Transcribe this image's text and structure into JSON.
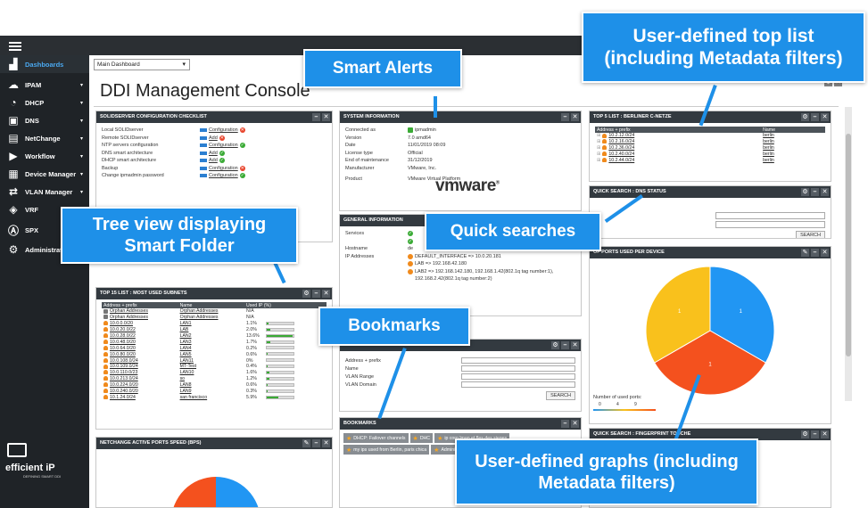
{
  "sidebar": {
    "items": [
      {
        "label": "Dashboards",
        "icon": "chart-icon"
      },
      {
        "label": "IPAM",
        "icon": "cloud-icon"
      },
      {
        "label": "DHCP",
        "icon": "gauge-icon"
      },
      {
        "label": "DNS",
        "icon": "dns-icon"
      },
      {
        "label": "NetChange",
        "icon": "switch-icon"
      },
      {
        "label": "Workflow",
        "icon": "workflow-icon"
      },
      {
        "label": "Device Manager",
        "icon": "server-icon"
      },
      {
        "label": "VLAN Manager",
        "icon": "arrows-icon"
      },
      {
        "label": "VRF",
        "icon": "layers-icon"
      },
      {
        "label": "SPX",
        "icon": "as-icon"
      },
      {
        "label": "Administration",
        "icon": "gear-icon"
      }
    ],
    "logo": "efficient iP",
    "logo_tag": "DEFINING SMART DDI"
  },
  "header": {
    "dashboard_select": "Main Dashboard",
    "title": "DDI Management Console"
  },
  "checklist": {
    "title": "SOLIDSERVER CONFIGURATION CHECKLIST",
    "rows": [
      {
        "k": "Local SOLIDserver",
        "v": "Configuration",
        "status": "red"
      },
      {
        "k": "Remote SOLIDserver",
        "v": "Add",
        "status": "red"
      },
      {
        "k": "NTP servers configuration",
        "v": "Configuration",
        "status": "green"
      },
      {
        "k": "DNS smart architecture",
        "v": "Add",
        "status": "green"
      },
      {
        "k": "DHCP smart architecture",
        "v": "Add",
        "status": "green"
      },
      {
        "k": "Backup",
        "v": "Configuration",
        "status": "red"
      },
      {
        "k": "Change ipmadmin password",
        "v": "Configuration",
        "status": "green"
      }
    ]
  },
  "sysinfo": {
    "title": "SYSTEM INFORMATION",
    "rows": [
      {
        "k": "Connected as",
        "v": "ipmadmin"
      },
      {
        "k": "Version",
        "v": "7.0 amd64"
      },
      {
        "k": "Date",
        "v": "11/01/2019 08:09"
      },
      {
        "k": "License type",
        "v": "Official"
      },
      {
        "k": "End of maintenance",
        "v": "31/12/2019"
      },
      {
        "k": "Manufacturer",
        "v": "VMware, Inc."
      },
      {
        "k": "Product",
        "v": "VMware Virtual Platform"
      }
    ],
    "vendor_logo": "vmware"
  },
  "general": {
    "title": "GENERAL INFORMATION",
    "rows": [
      {
        "k": "Services",
        "v": ""
      },
      {
        "k": "Hostname",
        "v": "de"
      },
      {
        "k": "IP Addresses",
        "v": "DEFAULT_INTERFACE => 10.0.20.181"
      }
    ],
    "extra_ips": [
      "LAB => 192.168.42.180",
      "LAB2 => 192.168.142.180, 192.168.1.42(802.1q tag number:1),",
      "192.168.2.42(802.1q tag number:2)"
    ]
  },
  "top5": {
    "title": "TOP 5 LIST : BERLINER C-NETZE",
    "headers": [
      "Address + prefix",
      "Name"
    ],
    "rows": [
      [
        "10.2.12.0/24",
        "berlin"
      ],
      [
        "10.2.16.0/24",
        "berlin"
      ],
      [
        "10.2.36.0/24",
        "berlin"
      ],
      [
        "10.2.40.0/24",
        "berlin"
      ],
      [
        "10.2.44.0/24",
        "berlin"
      ]
    ]
  },
  "dns_status": {
    "title": "QUICK SEARCH : DNS STATUS",
    "search_label": "SEARCH"
  },
  "ports_chart": {
    "title": "OF PORTS USED PER DEVICE",
    "legend_title": "Number of used ports:",
    "legend_ticks": [
      "0",
      "4",
      "9"
    ]
  },
  "chart_data": {
    "type": "pie",
    "values": [
      1,
      1,
      1
    ],
    "labels": [
      "1",
      "1",
      "1"
    ],
    "colors": [
      "#2196f3",
      "#f4511e",
      "#f9c11c"
    ]
  },
  "top15": {
    "title": "TOP 15 LIST : MOST USED SUBNETS",
    "headers": [
      "Address + prefix",
      "Name",
      "Used IP (%)"
    ],
    "rows": [
      [
        "Orphan Addresses",
        "Orphan Addresses",
        "N/A",
        0
      ],
      [
        "Orphan Addresses",
        "Orphan Addresses",
        "N/A",
        0
      ],
      [
        "10.0.0.0/20",
        "LAN1",
        "1.1%",
        0.011
      ],
      [
        "10.0.20.0/22",
        "LAB",
        "2.0%",
        0.02
      ],
      [
        "10.0.28.0/22",
        "LAN2",
        "13.6%",
        0.136
      ],
      [
        "10.0.48.0/20",
        "LAN3",
        "1.7%",
        0.017
      ],
      [
        "10.0.64.0/20",
        "LAN4",
        "0.2%",
        0.002
      ],
      [
        "10.0.80.0/20",
        "LAN5",
        "0.6%",
        0.006
      ],
      [
        "10.0.108.0/24",
        "LAN11",
        "0%",
        0
      ],
      [
        "10.0.109.0/24",
        "MT-Test",
        "0.4%",
        0.004
      ],
      [
        "10.0.110.0/23",
        "LAN10",
        "1.6%",
        0.016
      ],
      [
        "10.0.213.0/24",
        "so",
        "1.2%",
        0.012
      ],
      [
        "10.0.224.0/20",
        "LAN8",
        "0.6%",
        0.006
      ],
      [
        "10.0.240.0/20",
        "LAN9",
        "0.3%",
        0.003
      ],
      [
        "10.1.24.0/24",
        "san francisco",
        "5.9%",
        0.059
      ]
    ]
  },
  "netchange": {
    "title": "NETCHANGE ACTIVE PORTS SPEED (BPS)"
  },
  "vlan_search": {
    "fields": [
      "Address + prefix",
      "Name",
      "VLAN Range",
      "VLAN Domain"
    ],
    "search_label": "SEARCH"
  },
  "bookmarks": {
    "title": "BOOKMARKS",
    "items": [
      "DHCP: Failover channels",
      "DHC",
      "ip corp lmap et fles des sieges",
      "my ips used from Berlin, paris chica",
      "Administration: Class Studio desig"
    ]
  },
  "quick_search_bottom": {
    "title": "QUICK SEARCH : FINGERPRINT TOUCHE"
  },
  "callouts": {
    "smart_alerts": "Smart Alerts",
    "top_list": "User-defined top list (including Metadata filters)",
    "tree_view": "Tree view displaying Smart Folder",
    "quick_searches": "Quick searches",
    "bookmarks": "Bookmarks",
    "graphs": "User-defined graphs (including Metadata filters)"
  }
}
